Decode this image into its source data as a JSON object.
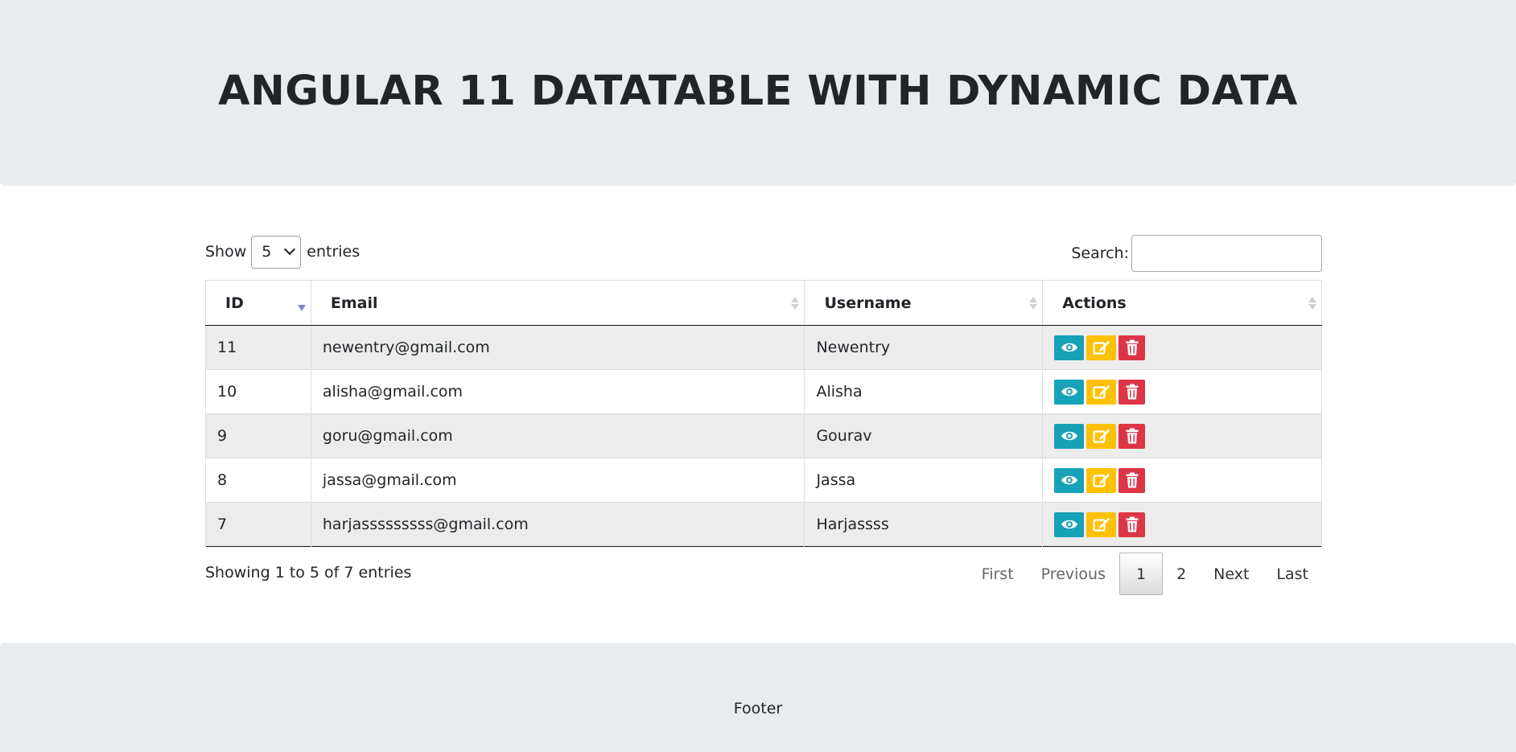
{
  "header": {
    "title": "ANGULAR 11 DATATABLE WITH DYNAMIC DATA"
  },
  "length_control": {
    "prefix": "Show",
    "selected": "5",
    "suffix": "entries"
  },
  "search": {
    "label": "Search:",
    "value": "",
    "placeholder": ""
  },
  "table": {
    "columns": [
      "ID",
      "Email",
      "Username",
      "Actions"
    ],
    "sorted_column": "ID",
    "sort_direction": "descending",
    "rows": [
      {
        "id": "11",
        "email": "newentry@gmail.com",
        "username": "Newentry"
      },
      {
        "id": "10",
        "email": "alisha@gmail.com",
        "username": "Alisha"
      },
      {
        "id": "9",
        "email": "goru@gmail.com",
        "username": "Gourav"
      },
      {
        "id": "8",
        "email": "jassa@gmail.com",
        "username": "Jassa"
      },
      {
        "id": "7",
        "email": "harjasssssssss@gmail.com",
        "username": "Harjassss"
      }
    ],
    "row_actions": [
      {
        "name": "view",
        "icon": "eye-icon",
        "color": "#17a2b8"
      },
      {
        "name": "edit",
        "icon": "edit-icon",
        "color": "#ffc107"
      },
      {
        "name": "delete",
        "icon": "trash-icon",
        "color": "#dc3545"
      }
    ]
  },
  "info": "Showing 1 to 5 of 7 entries",
  "pagination": {
    "first": "First",
    "previous": "Previous",
    "pages": [
      "1",
      "2"
    ],
    "current": "1",
    "next": "Next",
    "last": "Last"
  },
  "footer": {
    "text": "Footer"
  }
}
